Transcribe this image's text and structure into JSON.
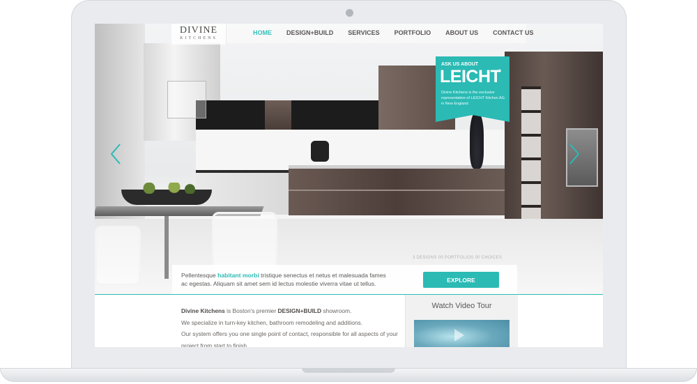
{
  "site": {
    "logo_main": "DIVINE",
    "logo_sub": "KITCHENS"
  },
  "nav": [
    {
      "label": "HOME",
      "active": true
    },
    {
      "label": "DESIGN+BUILD",
      "active": false
    },
    {
      "label": "SERVICES",
      "active": false
    },
    {
      "label": "PORTFOLIO",
      "active": false
    },
    {
      "label": "ABOUT US",
      "active": false
    },
    {
      "label": "CONTACT US",
      "active": false
    }
  ],
  "badge": {
    "pre": "ASK US ABOUT",
    "brand": "LEICHT",
    "reg": "®",
    "text": "Divine Kitchens is the exclusive representative of LEICHT Kitchen AG in New England."
  },
  "slider": {
    "counter": "3 DESIGNS  00 PORTFOLIOS  00 CHOICES"
  },
  "caption": {
    "pre": "Pellentesque ",
    "highlight": "habitant morbi",
    "post": " tristique senectus et netus et malesuada fames ac egestas. Aliquam sit amet sem id lectus molestie viverra vitae ut tellus.",
    "button": "EXPLORE"
  },
  "intro": {
    "brand": "Divine Kitchens",
    "line1_mid": " is Boston's premier ",
    "line1_bold": "DESIGN+BUILD",
    "line1_end": " showroom.",
    "line2": "We specialize in turn-key kitchen, bathroom remodeling and additions.",
    "line3": "Our system offers you one single point of contact, responsible for all aspects of your project from start to finish."
  },
  "video": {
    "title": "Watch Video Tour"
  },
  "colors": {
    "accent": "#2bbab4",
    "nav_text": "#5a5654"
  }
}
